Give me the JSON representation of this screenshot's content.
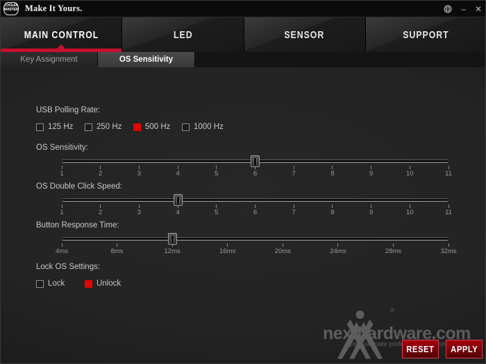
{
  "window": {
    "title": "Make It Yours.",
    "logo_text_line1": "COOLER",
    "logo_text_line2": "MASTER",
    "controls": {
      "language_icon": "globe-icon",
      "minimize": "–",
      "close": "✕"
    }
  },
  "main_tabs": [
    {
      "label": "MAIN CONTROL",
      "active": true
    },
    {
      "label": "LED",
      "active": false
    },
    {
      "label": "SENSOR",
      "active": false
    },
    {
      "label": "SUPPORT",
      "active": false
    }
  ],
  "sub_tabs": [
    {
      "label": "Key Assignment",
      "active": false
    },
    {
      "label": "OS Sensitivity",
      "active": true
    }
  ],
  "usb_polling_rate": {
    "label": "USB Polling Rate:",
    "options": [
      {
        "label": "125 Hz",
        "checked": false
      },
      {
        "label": "250 Hz",
        "checked": false
      },
      {
        "label": "500 Hz",
        "checked": true
      },
      {
        "label": "1000 Hz",
        "checked": false
      }
    ]
  },
  "os_sensitivity": {
    "label": "OS Sensitivity:",
    "ticks": [
      "1",
      "2",
      "3",
      "4",
      "5",
      "6",
      "7",
      "8",
      "9",
      "10",
      "11"
    ],
    "value_index": 5,
    "value": "6"
  },
  "os_double_click_speed": {
    "label": "OS Double Click Speed:",
    "ticks": [
      "1",
      "2",
      "3",
      "4",
      "5",
      "6",
      "7",
      "8",
      "9",
      "10",
      "11"
    ],
    "value_index": 3,
    "value": "4"
  },
  "button_response_time": {
    "label": "Button Response Time:",
    "ticks": [
      "4ms",
      "8ms",
      "12ms",
      "16ms",
      "20ms",
      "24ms",
      "28ms",
      "32ms"
    ],
    "value_index": 2,
    "value": "12ms"
  },
  "lock_os_settings": {
    "label": "Lock OS Settings:",
    "options": [
      {
        "label": "Lock",
        "checked": false
      },
      {
        "label": "Unlock",
        "checked": true
      }
    ]
  },
  "actions": {
    "reset_label": "RESET",
    "apply_label": "APPLY"
  },
  "watermark": {
    "name": "nexthardware.com",
    "tagline": "your ultimate professional resource",
    "registered": "®"
  },
  "colors": {
    "accent_red": "#c8102e",
    "checkbox_red": "#e10600",
    "panel_bg": "#232323",
    "titlebar_bg": "#0b0b0b"
  }
}
